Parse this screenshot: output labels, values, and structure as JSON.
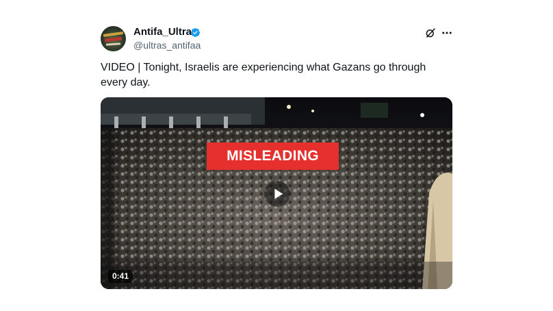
{
  "author": {
    "display_name": "Antifa_Ultras",
    "handle": "@ultras_antifaa",
    "verified_icon": "verified-badge-icon",
    "verified_color": "#1d9bf0"
  },
  "actions": {
    "grok_icon": "grok-icon",
    "more_icon": "more-options-icon"
  },
  "tweet": {
    "text": "VIDEO | Tonight, Israelis are experiencing what Gazans go through every day."
  },
  "media": {
    "overlay_label": "MISLEADING",
    "overlay_color": "#e5302e",
    "duration": "0:41",
    "play_icon": "play-icon"
  },
  "colors": {
    "text_primary": "#0f1419",
    "text_secondary": "#536471"
  }
}
